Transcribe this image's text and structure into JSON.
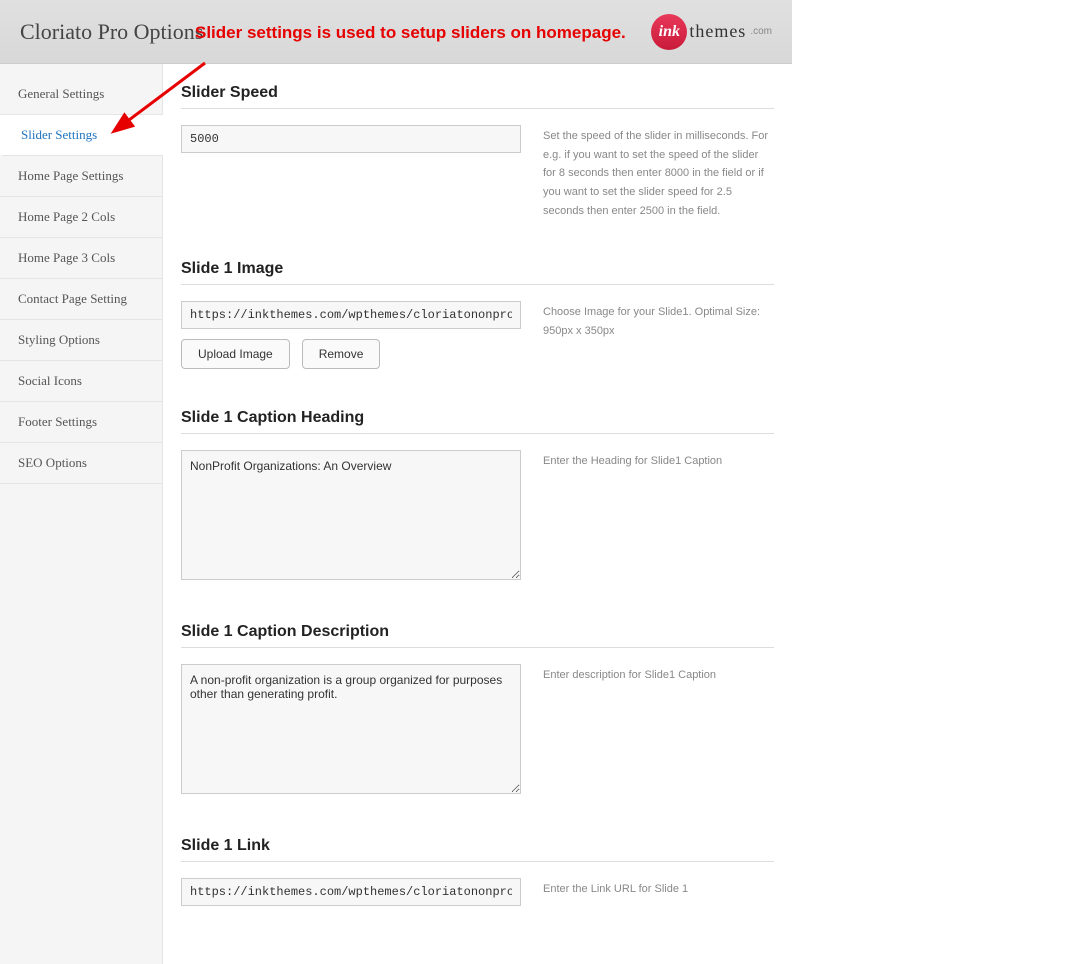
{
  "header": {
    "title": "Cloriato Pro Options",
    "logo_circle": "ink",
    "logo_text": "themes",
    "logo_suffix": ".com"
  },
  "annotation": {
    "text": "Slider settings is used to setup sliders on homepage."
  },
  "sidebar": {
    "items": [
      {
        "label": "General Settings",
        "active": false
      },
      {
        "label": "Slider Settings",
        "active": true
      },
      {
        "label": "Home Page Settings",
        "active": false
      },
      {
        "label": "Home Page 2 Cols",
        "active": false
      },
      {
        "label": "Home Page 3 Cols",
        "active": false
      },
      {
        "label": "Contact Page Setting",
        "active": false
      },
      {
        "label": "Styling Options",
        "active": false
      },
      {
        "label": "Social Icons",
        "active": false
      },
      {
        "label": "Footer Settings",
        "active": false
      },
      {
        "label": "SEO Options",
        "active": false
      }
    ]
  },
  "sections": {
    "slider_speed": {
      "title": "Slider Speed",
      "value": "5000",
      "help": "Set the speed of the slider in milliseconds. For e.g. if you want to set the speed of the slider for 8 seconds then enter 8000 in the field or if you want to set the slider speed for 2.5 seconds then enter 2500 in the field."
    },
    "slide1_image": {
      "title": "Slide 1 Image",
      "value": "https://inkthemes.com/wpthemes/cloriatononprofits/wp",
      "upload_label": "Upload Image",
      "remove_label": "Remove",
      "help": "Choose Image for your Slide1. Optimal Size: 950px x 350px"
    },
    "slide1_heading": {
      "title": "Slide 1 Caption Heading",
      "value": "NonProfit Organizations: An Overview",
      "help": "Enter the Heading for Slide1 Caption"
    },
    "slide1_desc": {
      "title": "Slide 1 Caption Description",
      "value": "A non-profit organization is a group organized for purposes other than generating profit.",
      "help": "Enter description for Slide1 Caption"
    },
    "slide1_link": {
      "title": "Slide 1 Link",
      "value": "https://inkthemes.com/wpthemes/cloriatononprofits/bl",
      "help": "Enter the Link URL for Slide 1"
    }
  }
}
